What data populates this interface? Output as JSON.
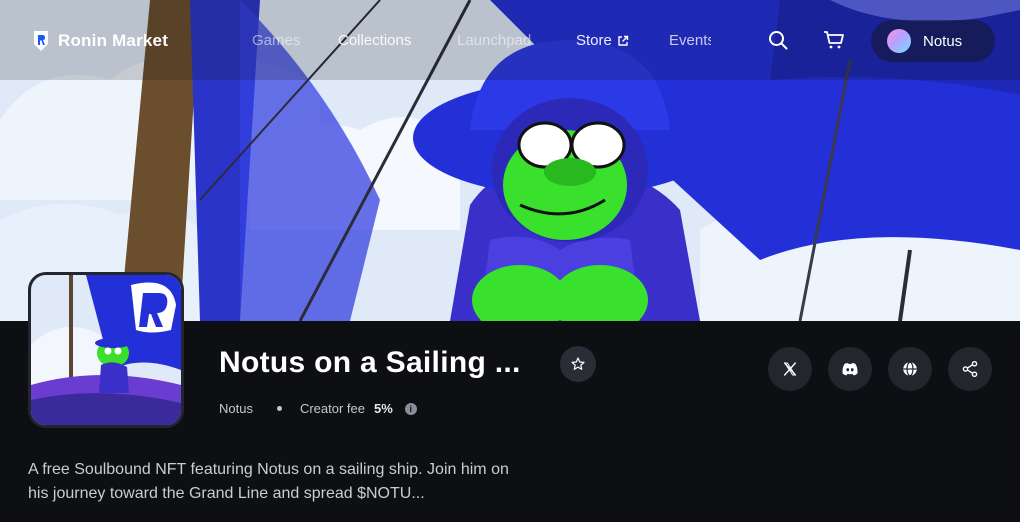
{
  "brand": {
    "name": "Ronin Market"
  },
  "nav": {
    "items": [
      {
        "label": "Games"
      },
      {
        "label": "Collections"
      },
      {
        "label": "Launchpad"
      },
      {
        "label": "Store"
      },
      {
        "label": "Events"
      }
    ],
    "icons": [
      "search-icon",
      "cart-icon",
      "external-link-icon"
    ],
    "user": {
      "name": "Notus"
    }
  },
  "collection": {
    "title": "Notus on a Sailing ...",
    "creator": "Notus",
    "creator_fee_label": "Creator fee",
    "creator_fee_value": "5%",
    "description": "A free Soulbound NFT featuring Notus on a sailing ship. Join him on his journey toward the Grand Line and spread $NOTU...",
    "social_icons": [
      "x-icon",
      "discord-icon",
      "globe-icon",
      "share-icon"
    ]
  },
  "colors": {
    "page_bg": "#0e0f13",
    "button_bg": "#23262d",
    "sail_blue": "#2330d8",
    "ape_green": "#39e02c"
  }
}
